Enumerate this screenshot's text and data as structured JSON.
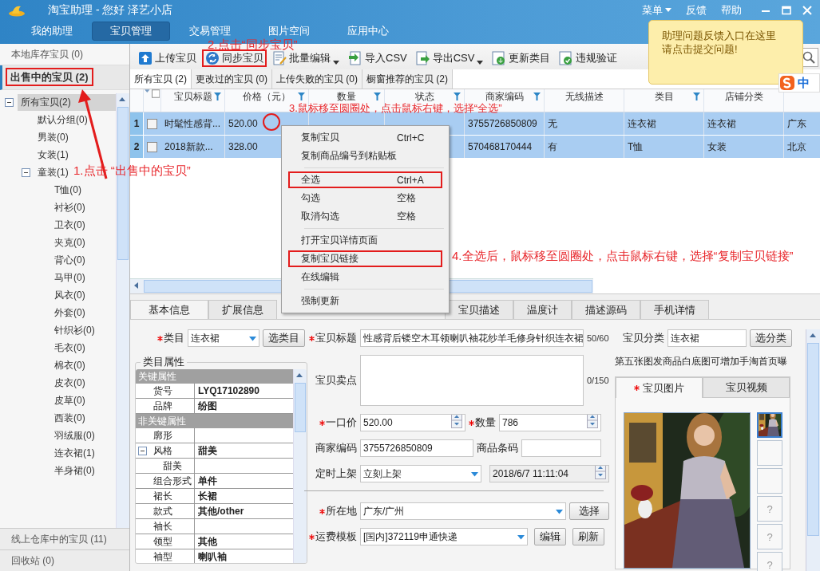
{
  "window": {
    "title": "淘宝助理 - 您好 泽艺小店",
    "menu": "菜单",
    "links": [
      "反馈",
      "帮助"
    ]
  },
  "nav": [
    {
      "label": "我的助理",
      "selected": false
    },
    {
      "label": "宝贝管理",
      "selected": true
    },
    {
      "label": "交易管理",
      "selected": false
    },
    {
      "label": "图片空间",
      "selected": false
    },
    {
      "label": "应用中心",
      "selected": false
    }
  ],
  "tooltip": {
    "lines": [
      "助理问题反馈入口在这里",
      "请点击提交问题!"
    ]
  },
  "ime": {
    "label": "中"
  },
  "sidebar": {
    "top": [
      {
        "label": "本地库存宝贝 (0)",
        "selected": false,
        "highlighted": false
      },
      {
        "label": "出售中的宝贝 (2)",
        "selected": true,
        "highlighted": true
      }
    ],
    "tree": [
      {
        "label": "所有宝贝(2)",
        "selected": true,
        "expanded": true,
        "children": [
          {
            "label": "默认分组(0)",
            "selected": false
          },
          {
            "label": "男装(0)",
            "selected": false
          },
          {
            "label": "女装(1)",
            "selected": false
          },
          {
            "label": "童装(1)",
            "selected": false,
            "expanded": true,
            "children": [
              {
                "label": "T恤(0)",
                "selected": false
              },
              {
                "label": "衬衫(0)",
                "selected": false
              },
              {
                "label": "卫衣(0)",
                "selected": false
              },
              {
                "label": "夹克(0)",
                "selected": false
              },
              {
                "label": "背心(0)",
                "selected": false
              },
              {
                "label": "马甲(0)",
                "selected": false
              },
              {
                "label": "风衣(0)",
                "selected": false
              },
              {
                "label": "外套(0)",
                "selected": false
              },
              {
                "label": "针织衫(0)",
                "selected": false
              },
              {
                "label": "毛衣(0)",
                "selected": false
              },
              {
                "label": "棉衣(0)",
                "selected": false
              },
              {
                "label": "皮衣(0)",
                "selected": false
              },
              {
                "label": "皮草(0)",
                "selected": false
              },
              {
                "label": "西装(0)",
                "selected": false
              },
              {
                "label": "羽绒服(0)",
                "selected": false
              },
              {
                "label": "连衣裙(1)",
                "selected": false
              },
              {
                "label": "半身裙(0)",
                "selected": false
              }
            ]
          }
        ]
      }
    ],
    "bottom": [
      {
        "label": "线上仓库中的宝贝 (11)"
      },
      {
        "label": "回收站 (0)"
      }
    ]
  },
  "toolbar": [
    {
      "label": "上传宝贝",
      "dropdown": false,
      "highlighted": false
    },
    {
      "label": "同步宝贝",
      "dropdown": false,
      "highlighted": true
    },
    {
      "label": "批量编辑",
      "dropdown": true,
      "highlighted": false
    },
    {
      "label": "导入CSV",
      "dropdown": false,
      "highlighted": false
    },
    {
      "label": "导出CSV",
      "dropdown": true,
      "highlighted": false
    },
    {
      "label": "更新类目",
      "dropdown": false,
      "highlighted": false
    },
    {
      "label": "违规验证",
      "dropdown": false,
      "highlighted": false
    }
  ],
  "subtabs": [
    {
      "label": "所有宝贝 (2)",
      "selected": true
    },
    {
      "label": "更改过的宝贝 (0)",
      "selected": false
    },
    {
      "label": "上传失败的宝贝 (0)",
      "selected": false
    },
    {
      "label": "橱窗推荐的宝贝 (2)",
      "selected": false
    }
  ],
  "grid": {
    "header_checked": false,
    "columns": [
      {
        "label": "宝贝标题",
        "filter": true
      },
      {
        "label": "价格（元）",
        "filter": true
      },
      {
        "label": "数量",
        "filter": true
      },
      {
        "label": "状态",
        "filter": true
      },
      {
        "label": "商家编码",
        "filter": true
      },
      {
        "label": "无线描述",
        "filter": false
      },
      {
        "label": "类目",
        "filter": true
      },
      {
        "label": "店铺分类",
        "filter": false
      },
      {
        "filter": false
      }
    ],
    "rows": [
      {
        "number": "1",
        "selected": true,
        "checked": false,
        "cells": {
          "title": "时髦性感背...",
          "price": "520.00",
          "code": "3755726850809",
          "wireless": "无",
          "category": "连衣裙",
          "shop_category": "连衣裙",
          "column_10": "广东"
        }
      },
      {
        "number": "2",
        "selected": true,
        "checked": false,
        "cells": {
          "title": "2018新款...",
          "price": "328.00",
          "code": "570468170444",
          "wireless": "有",
          "category": "T恤",
          "shop_category": "女装",
          "column_10": "北京"
        }
      }
    ]
  },
  "context_menu": [
    {
      "kind": "item",
      "label": "复制宝贝",
      "shortcut": "Ctrl+C",
      "highlighted": false
    },
    {
      "kind": "item",
      "label": "复制商品编号到粘贴板",
      "highlighted": false
    },
    {
      "kind": "separator"
    },
    {
      "kind": "item",
      "label": "全选",
      "shortcut": "Ctrl+A",
      "highlighted": true
    },
    {
      "kind": "item",
      "label": "勾选",
      "shortcut": "空格",
      "highlighted": false
    },
    {
      "kind": "item",
      "label": "取消勾选",
      "shortcut": "空格",
      "highlighted": false
    },
    {
      "kind": "separator"
    },
    {
      "kind": "item",
      "label": "打开宝贝详情页面",
      "highlighted": false
    },
    {
      "kind": "item",
      "label": "复制宝贝链接",
      "highlighted": true
    },
    {
      "kind": "item",
      "label": "在线编辑",
      "highlighted": false
    },
    {
      "kind": "separator"
    },
    {
      "kind": "item",
      "label": "强制更新",
      "highlighted": false
    }
  ],
  "detail_tabs": [
    {
      "label": "基本信息",
      "selected": true
    },
    {
      "label": "扩展信息",
      "selected": false
    },
    {
      "label": "宝贝描述",
      "selected": false
    },
    {
      "label": "温度计",
      "selected": false
    },
    {
      "label": "描述源码",
      "selected": false
    },
    {
      "label": "手机详情",
      "selected": false
    }
  ],
  "form": {
    "category": {
      "label": "类目",
      "required": true,
      "value": "连衣裙",
      "button": "选类目"
    },
    "attributes": {
      "legend": "类目属性",
      "groups": [
        {
          "label": "关键属性",
          "rows": [
            {
              "name": "货号",
              "value": "LYQ17102890"
            },
            {
              "name": "品牌",
              "value": "纷图"
            }
          ]
        },
        {
          "label": "非关键属性",
          "rows": [
            {
              "name": "廓形"
            },
            {
              "name": "风格",
              "value": "甜美",
              "expanded": true,
              "children": [
                {
                  "name": "甜美"
                }
              ]
            },
            {
              "name": "组合形式",
              "value": "单件"
            },
            {
              "name": "裙长",
              "value": "长裙"
            },
            {
              "name": "款式",
              "value": "其他/other"
            },
            {
              "name": "袖长"
            },
            {
              "name": "领型",
              "value": "其他"
            },
            {
              "name": "袖型",
              "value": "喇叭袖"
            }
          ]
        }
      ]
    },
    "title": {
      "label": "宝贝标题",
      "required": true,
      "value": "性感背后镂空木耳领喇叭袖花纱羊毛修身针织连衣裙",
      "count": "50/60"
    },
    "selling_point": {
      "label": "宝贝卖点",
      "required": false,
      "count": "0/150"
    },
    "price": {
      "label": "一口价",
      "required": true,
      "value": "520.00"
    },
    "quantity": {
      "label": "数量",
      "required": true,
      "value": "786"
    },
    "merchant_code": {
      "label": "商家编码",
      "required": false,
      "value": "3755726850809"
    },
    "barcode": {
      "label": "商品条码",
      "required": false
    },
    "schedule": {
      "label": "定时上架",
      "required": false,
      "value": "立刻上架",
      "time": "2018/6/7 11:11:04"
    },
    "location": {
      "label": "所在地",
      "required": true,
      "value": "广东/广州",
      "button": "选择"
    },
    "shipping": {
      "label": "运费模板",
      "required": true,
      "value": "[国内]372119申通快递",
      "buttons": [
        "编辑",
        "刷新"
      ]
    },
    "shop_category": {
      "label": "宝贝分类",
      "required": false,
      "value": "连衣裙",
      "button": "选分类"
    },
    "notice": "第五张图发商品白底图可增加手淘首页曝",
    "media_tabs": [
      {
        "label": "宝贝图片",
        "required": true,
        "selected": true
      },
      {
        "label": "宝贝视频",
        "required": false,
        "selected": false
      }
    ],
    "thumbnails": [
      {
        "kind": "picture",
        "selected": true
      },
      {
        "kind": "empty",
        "selected": false
      },
      {
        "kind": "empty",
        "selected": false
      },
      {
        "kind": "placeholder",
        "label": "?",
        "selected": false
      },
      {
        "kind": "placeholder",
        "label": "?",
        "selected": false
      },
      {
        "kind": "placeholder",
        "label": "?",
        "selected": false
      }
    ]
  },
  "annotations": [
    {
      "text": "1.点击 “出售中的宝贝”"
    },
    {
      "text": "2.点击“同步宝贝”"
    },
    {
      "text": "3.鼠标移至圆圈处，点击鼠标右键，选择“全选”"
    },
    {
      "text": "4.全选后，鼠标移至圆圈处，点击鼠标右键，选择“复制宝贝链接”"
    }
  ]
}
